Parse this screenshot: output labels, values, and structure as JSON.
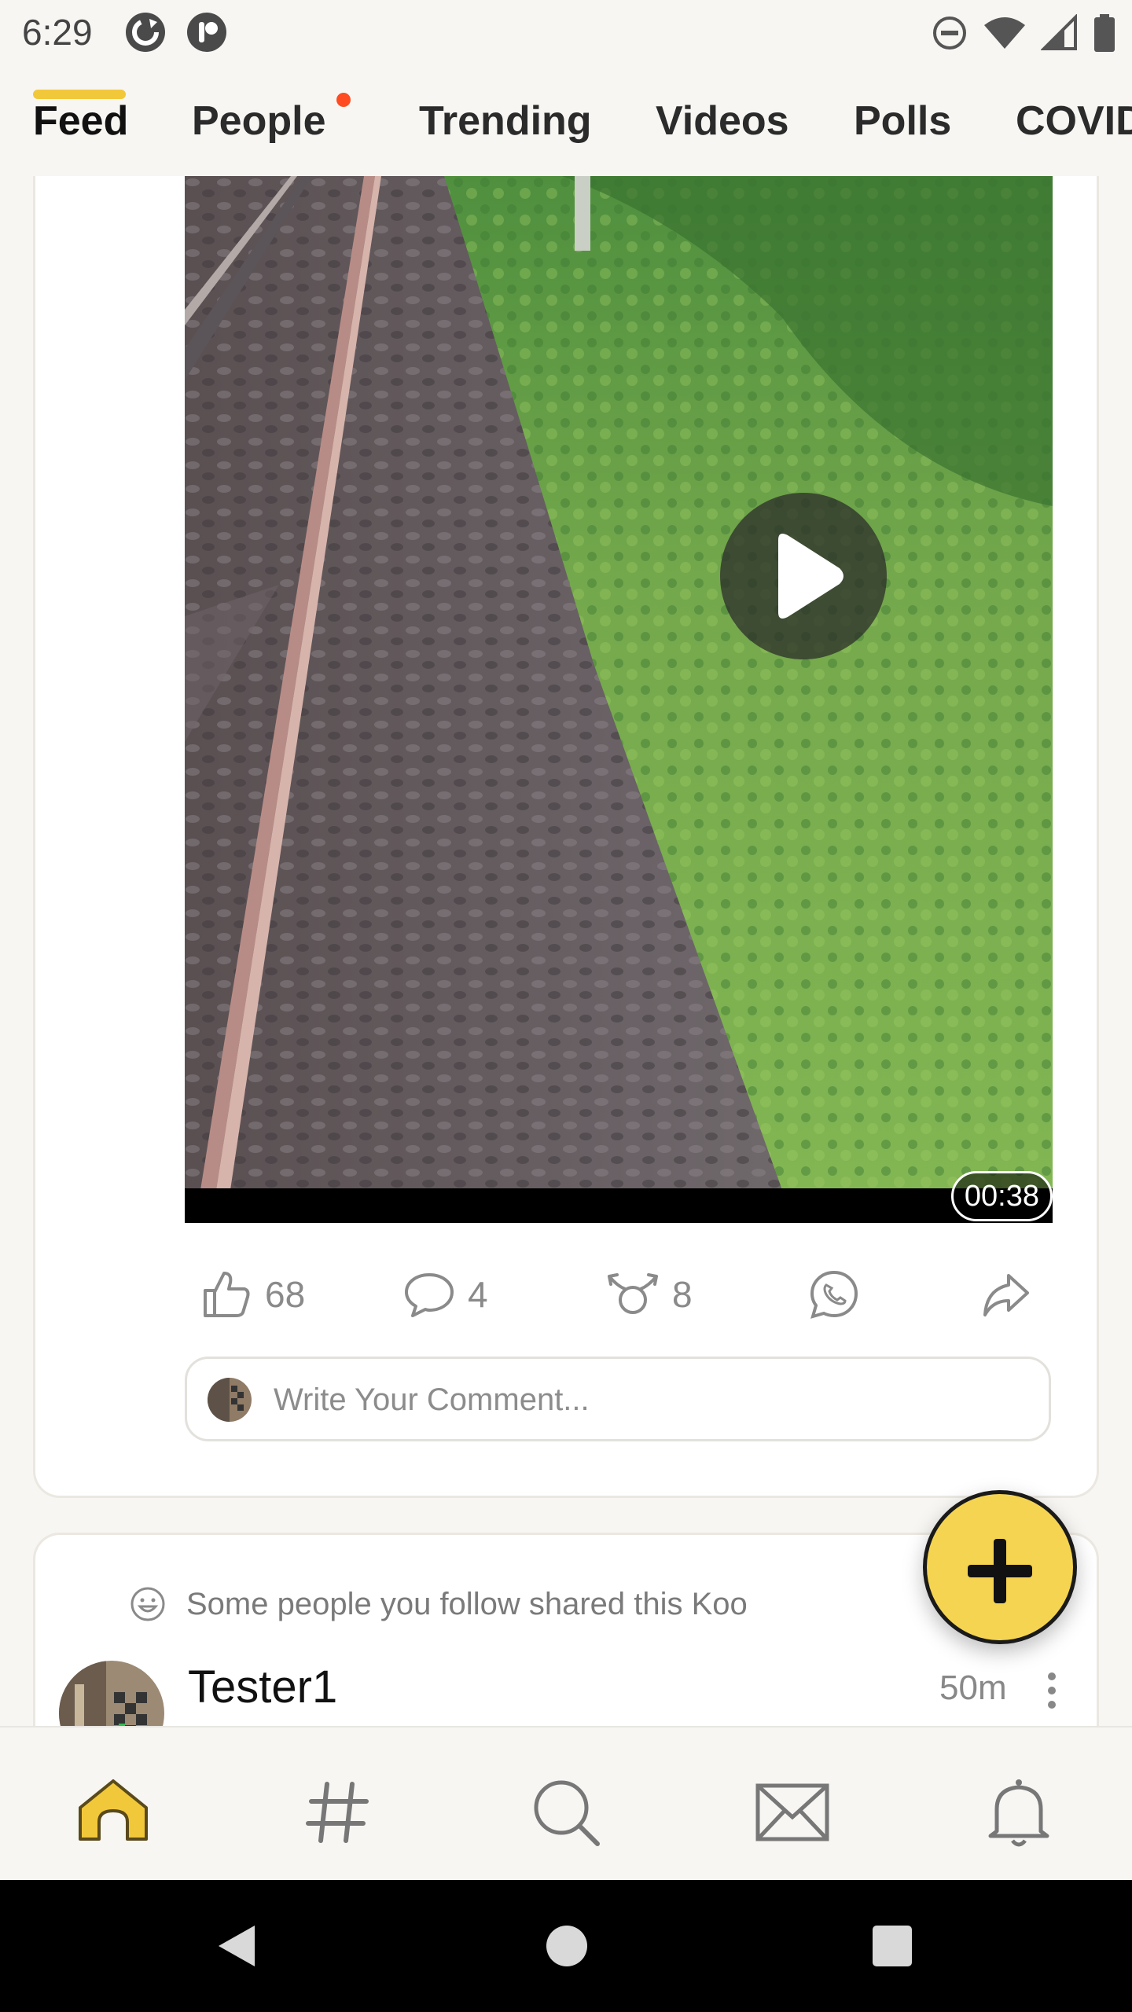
{
  "status_bar": {
    "time": "6:29",
    "left_icons": [
      "sync-app-icon",
      "koo-app-icon"
    ],
    "right_icons": [
      "do-not-disturb-icon",
      "wifi-icon",
      "cellular-signal-icon",
      "battery-icon"
    ]
  },
  "tabs": {
    "items": [
      {
        "label": "Feed",
        "active": true
      },
      {
        "label": "People",
        "active": false,
        "has_notification_dot": true
      },
      {
        "label": "Trending",
        "active": false
      },
      {
        "label": "Videos",
        "active": false
      },
      {
        "label": "Polls",
        "active": false
      },
      {
        "label": "COVID",
        "active": false
      }
    ],
    "accent_color": "#f2c83b",
    "dot_color": "#ff4b1f"
  },
  "post": {
    "video": {
      "duration": "00:38",
      "play_icon": "play-icon"
    },
    "actions": {
      "likes": "68",
      "comments": "4",
      "rekoos": "8",
      "like_icon": "thumbs-up-icon",
      "comment_icon": "comment-bubble-icon",
      "rekoo_icon": "rekoo-icon",
      "whatsapp_icon": "whatsapp-icon",
      "share_icon": "share-icon"
    },
    "comment": {
      "placeholder": "Write Your Comment..."
    }
  },
  "next_post": {
    "shared_note": "Some people you follow shared this Koo",
    "author": "Tester1",
    "time_ago": "50m"
  },
  "fab": {
    "icon": "plus-icon",
    "color": "#f5d451"
  },
  "bottom_nav": {
    "items": [
      {
        "icon": "home-icon",
        "active": true
      },
      {
        "icon": "hashtag-icon",
        "active": false
      },
      {
        "icon": "search-icon",
        "active": false
      },
      {
        "icon": "mail-icon",
        "active": false
      },
      {
        "icon": "bell-icon",
        "active": false
      }
    ],
    "active_color": "#f2c83b"
  },
  "system_nav": [
    "back-icon",
    "home-circle-icon",
    "recents-icon"
  ]
}
